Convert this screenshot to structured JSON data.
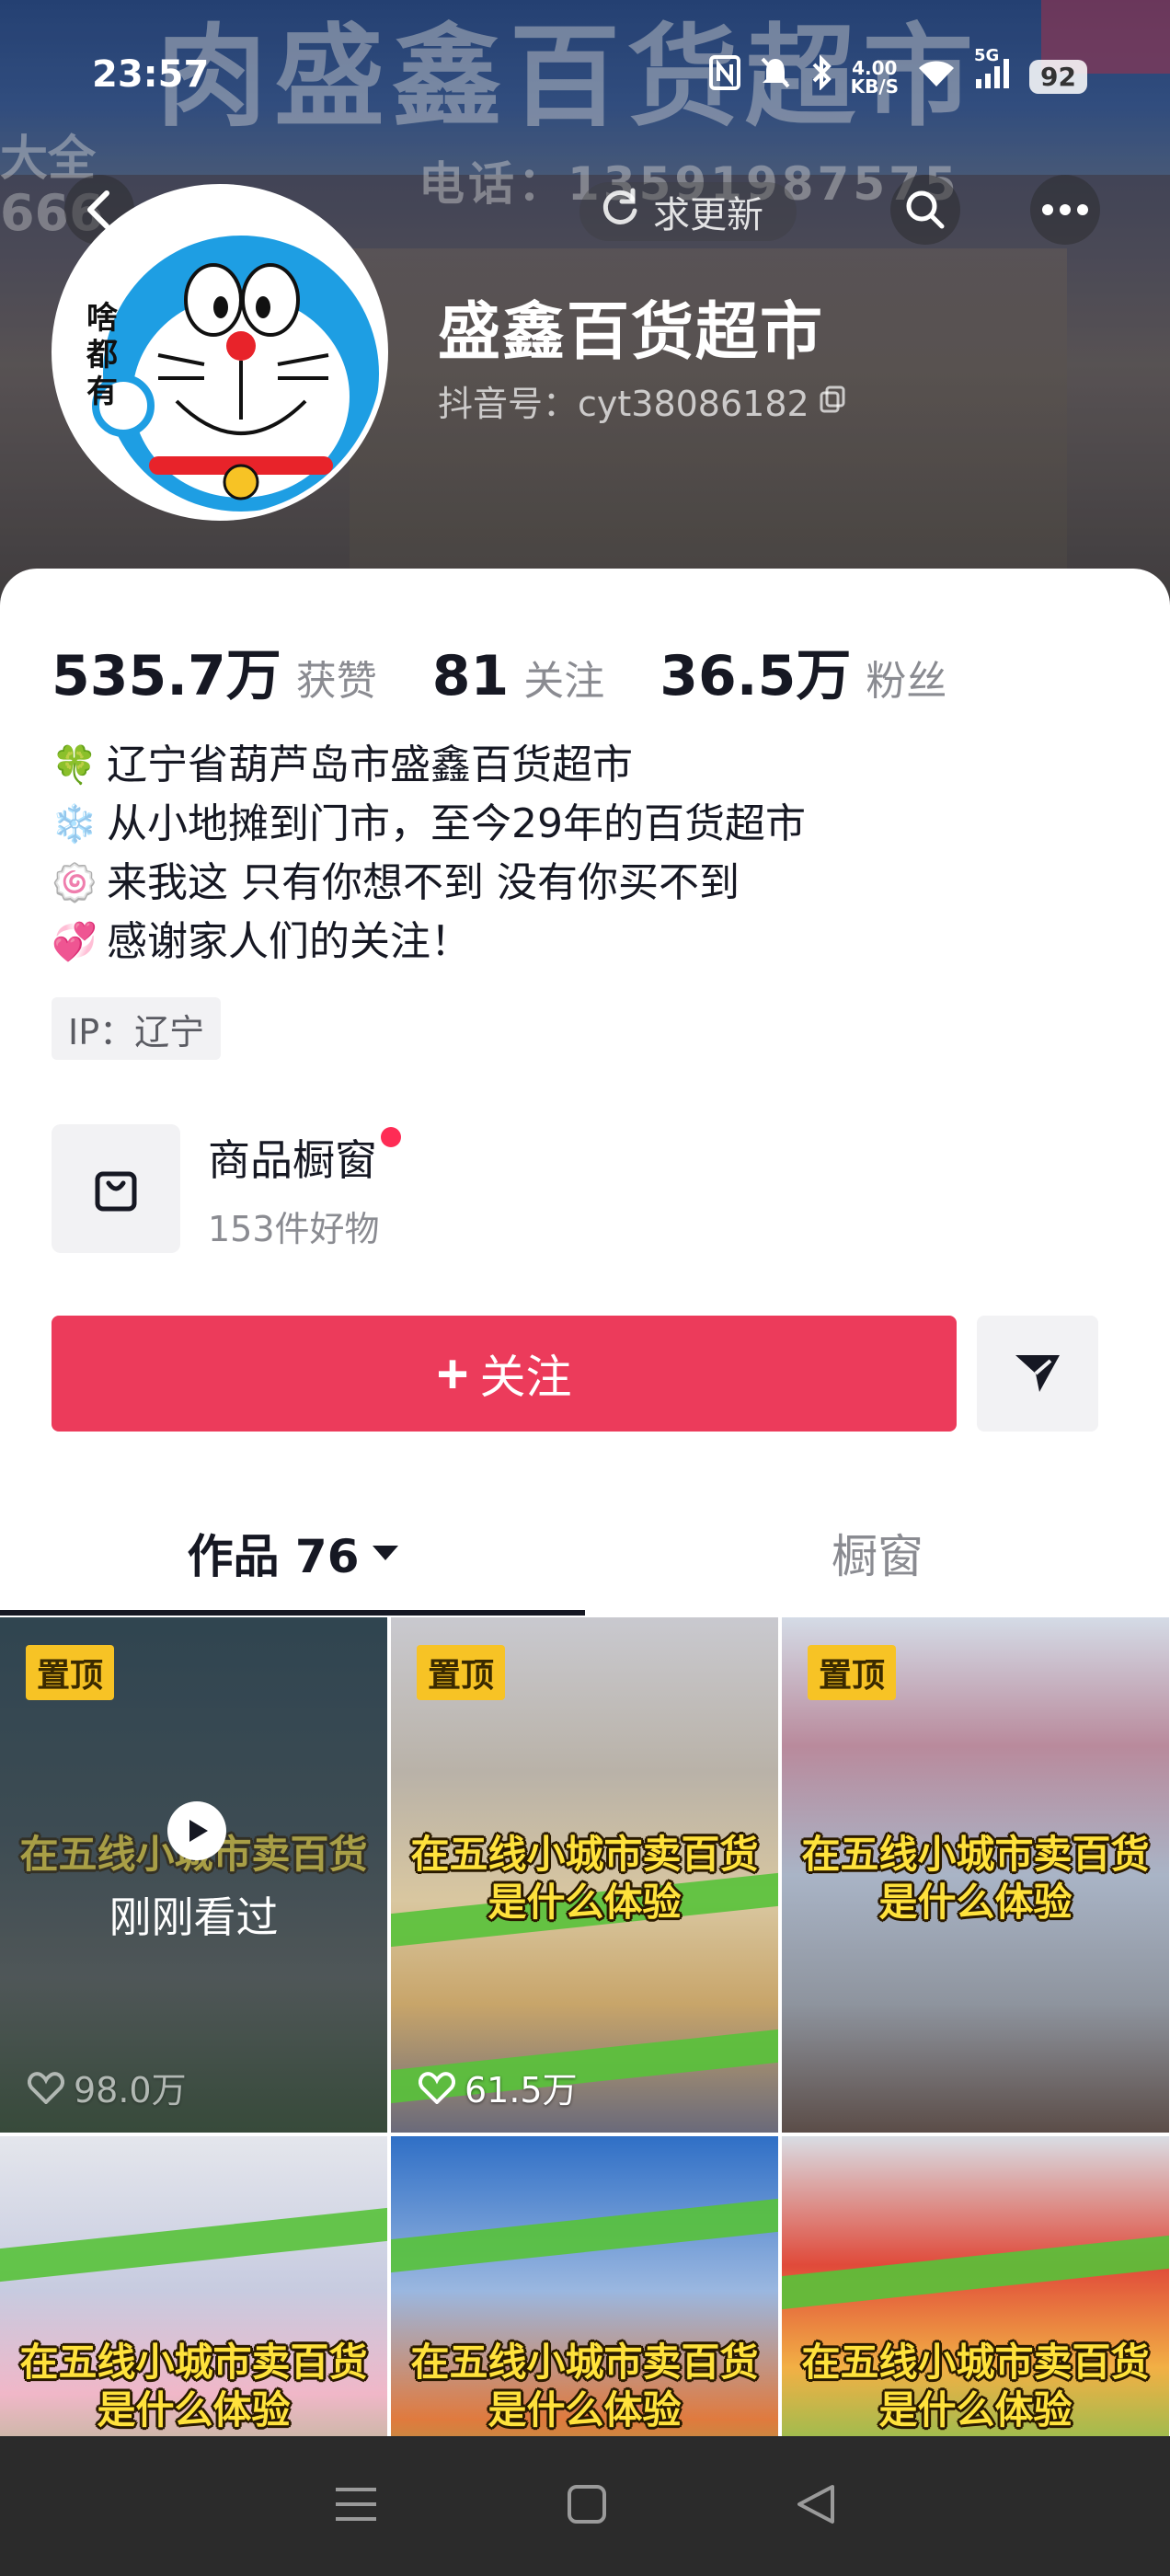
{
  "status_bar": {
    "time": "23:57",
    "speed": "4.00",
    "speed_unit": "KB/S",
    "network": "5G",
    "battery": "92"
  },
  "cover": {
    "sign_text": "肉盛鑫百货超市",
    "sign_left_1": "大全",
    "sign_left_2": "666",
    "sign_phone": "电话：13591987575"
  },
  "top_nav": {
    "update_label": "求更新"
  },
  "profile": {
    "avatar_text": "啥都有",
    "name": "盛鑫百货超市",
    "id_label": "抖音号：cyt38086182"
  },
  "stats": [
    {
      "value": "535.7万",
      "label": "获赞"
    },
    {
      "value": "81",
      "label": "关注"
    },
    {
      "value": "36.5万",
      "label": "粉丝"
    }
  ],
  "bio": [
    {
      "emoji": "🍀",
      "text": "辽宁省葫芦岛市盛鑫百货超市"
    },
    {
      "emoji": "❄️",
      "text": "从小地摊到门市，至今29年的百货超市"
    },
    {
      "emoji": "🍥",
      "text": "来我这 只有你想不到 没有你买不到"
    },
    {
      "emoji": "💞",
      "text": "感谢家人们的关注！"
    }
  ],
  "ip_tag": "IP：辽宁",
  "shop_window": {
    "title": "商品橱窗",
    "subtitle": "153件好物"
  },
  "actions": {
    "follow_label": "关注",
    "follow_color": "#ec3b5b"
  },
  "tabs": [
    {
      "label": "作品 76"
    },
    {
      "label": "橱窗"
    }
  ],
  "videos": [
    {
      "pinned": "置顶",
      "caption_1": "在五线小城市卖百货",
      "likes": "98.0万",
      "watched": "刚刚看过"
    },
    {
      "pinned": "置顶",
      "caption_1": "在五线小城市卖百货",
      "caption_2": "是什么体验",
      "likes": "61.5万"
    },
    {
      "pinned": "置顶",
      "caption_1": "在五线小城市卖百货",
      "caption_2": "是什么体验"
    },
    {
      "caption_1": "在五线小城市卖百货",
      "caption_2": "是什么体验"
    },
    {
      "caption_1": "在五线小城市卖百货",
      "caption_2": "是什么体验"
    },
    {
      "caption_1": "在五线小城市卖百货",
      "caption_2": "是什么体验"
    }
  ]
}
